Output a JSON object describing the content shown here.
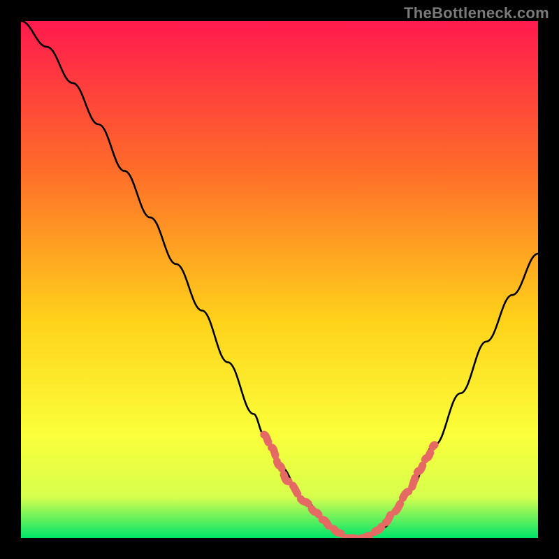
{
  "watermark": {
    "text": "TheBottleneck.com"
  },
  "colors": {
    "bg": "#000000",
    "grad_top": "#ff1a4d",
    "grad_mid1": "#ff6a2a",
    "grad_mid2": "#ffd21a",
    "grad_mid3": "#faff3a",
    "grad_low": "#d7ff4d",
    "grad_bottom": "#00e46a",
    "curve": "#000000",
    "marker": "#e66a64"
  },
  "chart_data": {
    "type": "line",
    "title": "",
    "xlabel": "",
    "ylabel": "",
    "xlim": [
      0,
      100
    ],
    "ylim": [
      0,
      100
    ],
    "x": [
      0,
      5,
      10,
      15,
      20,
      25,
      30,
      35,
      40,
      45,
      47,
      50,
      55,
      60,
      63,
      65,
      67,
      70,
      75,
      80,
      85,
      90,
      95,
      100
    ],
    "values": [
      100,
      95,
      88,
      80,
      71,
      62,
      53,
      44,
      34,
      24,
      20,
      14,
      7,
      2,
      0,
      0,
      0,
      2,
      9,
      18,
      28,
      38,
      47,
      55
    ],
    "markers_x": [
      47,
      48.5,
      50,
      51.5,
      55,
      57,
      58.5,
      60,
      61.5,
      63,
      64.5,
      66,
      67.5,
      69,
      70.5,
      72,
      75,
      77,
      78.5,
      80
    ],
    "markers_y": [
      20,
      17.5,
      14,
      11,
      7,
      5,
      3.5,
      2,
      1,
      0,
      0,
      0,
      0.5,
      1.5,
      3,
      5,
      9,
      13,
      15.5,
      18
    ]
  }
}
